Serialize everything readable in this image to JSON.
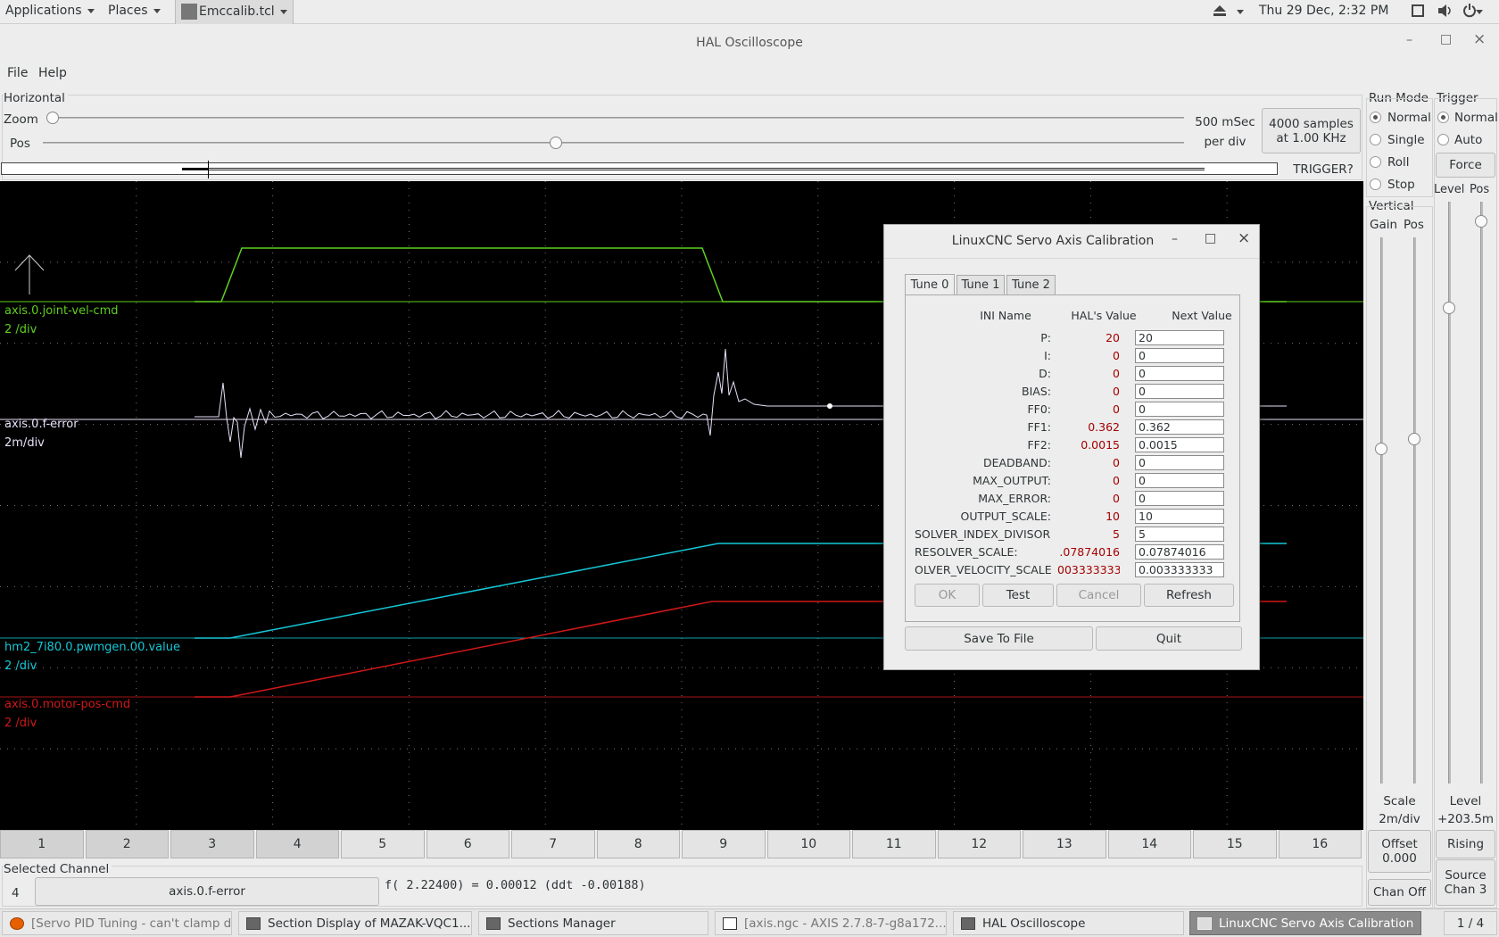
{
  "topbar": {
    "applications": "Applications",
    "places": "Places",
    "app": "Emccalib.tcl",
    "datetime": "Thu 29 Dec,  2:32 PM"
  },
  "window": {
    "title": "HAL Oscilloscope",
    "min": "–",
    "max": "□",
    "close": "×"
  },
  "menu": {
    "file": "File",
    "help": "Help"
  },
  "horizontal": {
    "group": "Horizontal",
    "zoom": "Zoom",
    "pos": "Pos",
    "time_line1": "500 mSec",
    "time_line2": "per div",
    "samples_line1": "4000 samples",
    "samples_line2": "at 1.00 KHz",
    "trigger_status": "TRIGGER?",
    "zoom_value": 0.0,
    "pos_value": 0.45
  },
  "run_mode": {
    "title": "Run Mode",
    "options": [
      "Normal",
      "Single",
      "Roll",
      "Stop"
    ],
    "selected": "Normal"
  },
  "trigger": {
    "title": "Trigger",
    "options": [
      "Normal",
      "Auto"
    ],
    "selected": "Normal",
    "force": "Force",
    "level_label": "Level",
    "pos_label": "Pos",
    "level_bottom": "Level",
    "level_value": "+203.5m",
    "edge": "Rising",
    "source_line1": "Source",
    "source_line2": "Chan  3"
  },
  "vertical": {
    "title": "Vertical",
    "gain": "Gain",
    "pos": "Pos",
    "scale_label": "Scale",
    "scale_value": "2m/div",
    "offset_label": "Offset",
    "offset_value": "0.000",
    "chan_off": "Chan Off"
  },
  "traces": [
    {
      "name": "axis.0.joint-vel-cmd",
      "scale": "2 /div",
      "color": "#5fcf1f"
    },
    {
      "name": "axis.0.f-error",
      "scale": "2m/div",
      "color": "#e8e0f8"
    },
    {
      "name": "hm2_7i80.0.pwmgen.00.value",
      "scale": "2 /div",
      "color": "#15c8d8"
    },
    {
      "name": "axis.0.motor-pos-cmd",
      "scale": "2 /div",
      "color": "#d01818"
    }
  ],
  "channels": [
    "1",
    "2",
    "3",
    "4",
    "5",
    "6",
    "7",
    "8",
    "9",
    "10",
    "11",
    "12",
    "13",
    "14",
    "15",
    "16"
  ],
  "active_channels": [
    "1",
    "2",
    "3",
    "4"
  ],
  "selected_channel": {
    "label": "Selected Channel",
    "number": "4",
    "name": "axis.0.f-error",
    "readout": "f( 2.22400) =  0.00012 (ddt -0.00188)"
  },
  "dialog": {
    "title": "LinuxCNC Servo Axis Calibration",
    "tabs": [
      "Tune 0",
      "Tune 1",
      "Tune 2"
    ],
    "col_ini": "INI Name",
    "col_hal": "HAL's Value",
    "col_next": "Next Value",
    "rows": [
      {
        "name": "P:",
        "hal": "20",
        "next": "20"
      },
      {
        "name": "I:",
        "hal": "0",
        "next": "0"
      },
      {
        "name": "D:",
        "hal": "0",
        "next": "0"
      },
      {
        "name": "BIAS:",
        "hal": "0",
        "next": "0"
      },
      {
        "name": "FF0:",
        "hal": "0",
        "next": "0"
      },
      {
        "name": "FF1:",
        "hal": "0.362",
        "next": "0.362"
      },
      {
        "name": "FF2:",
        "hal": "0.0015",
        "next": "0.0015"
      },
      {
        "name": "DEADBAND:",
        "hal": "0",
        "next": "0"
      },
      {
        "name": "MAX_OUTPUT:",
        "hal": "0",
        "next": "0"
      },
      {
        "name": "MAX_ERROR:",
        "hal": "0",
        "next": "0"
      },
      {
        "name": "OUTPUT_SCALE:",
        "hal": "10",
        "next": "10"
      },
      {
        "name": "SOLVER_INDEX_DIVISOR:",
        "hal": "5",
        "next": "5"
      },
      {
        "name": "RESOLVER_SCALE:",
        "hal": ".07874016",
        "next": "0.07874016"
      },
      {
        "name": "OLVER_VELOCITY_SCALE:",
        "hal": "003333333",
        "next": "0.003333333"
      }
    ],
    "ok": "OK",
    "test": "Test",
    "cancel": "Cancel",
    "refresh": "Refresh",
    "save": "Save To File",
    "quit": "Quit"
  },
  "taskbar": [
    {
      "label": "[Servo PID Tuning - can't clamp d...",
      "active": false
    },
    {
      "label": "Section Display of MAZAK-VQC1...",
      "active": false
    },
    {
      "label": "Sections Manager",
      "active": false
    },
    {
      "label": "[axis.ngc - AXIS 2.7.8-7-g8a172...",
      "active": false
    },
    {
      "label": "HAL Oscilloscope",
      "active": false
    },
    {
      "label": "LinuxCNC Servo Axis Calibration",
      "active": true
    }
  ],
  "workspace": "1 / 4"
}
